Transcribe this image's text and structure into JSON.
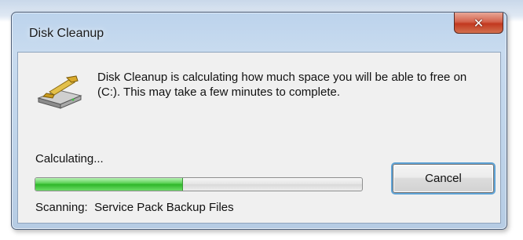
{
  "window": {
    "title": "Disk Cleanup",
    "close_glyph": "✕"
  },
  "dialog": {
    "icon": "disk-cleanup-icon",
    "message": "Disk Cleanup is calculating how much space you will be able to free on  (C:). This may take a few minutes to complete.",
    "status_label": "Calculating...",
    "progress_fraction": 0.45,
    "cancel_label": "Cancel",
    "scanning_prefix": "Scanning:",
    "scanning_item": "Service Pack Backup Files"
  }
}
